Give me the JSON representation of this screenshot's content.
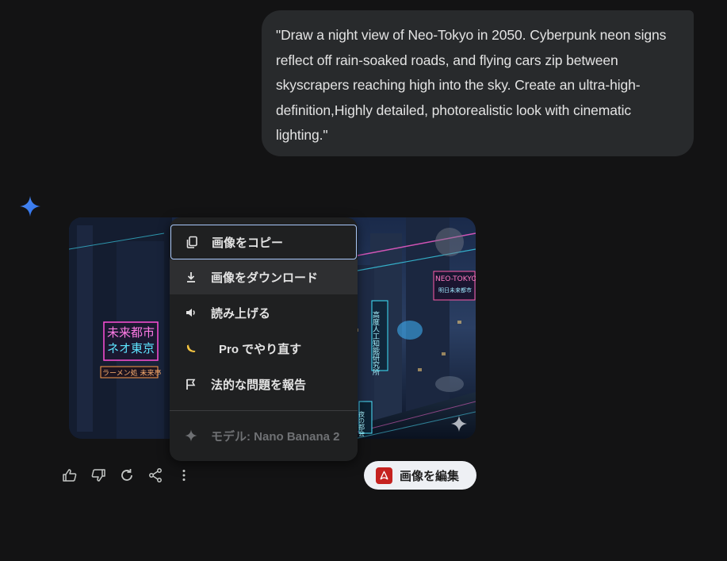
{
  "prompt": {
    "text": "\"Draw a night view of Neo-Tokyo in 2050. Cyberpunk neon signs reflect off rain-soaked roads, and flying cars zip between skyscrapers reaching high into the sky. Create an ultra-high-definition,Highly detailed, photorealistic look with cinematic lighting.\""
  },
  "response": {
    "avatar_icon": "gemini-sparkle-icon",
    "image": {
      "signs": {
        "left_1": "未来都市",
        "left_2": "ネオ東京",
        "ramen": "ラーメン処 未来亭",
        "right_top": "NEO-TOKYO",
        "right_sub": "明日未来都市",
        "vertical": "高度人工知能研究所",
        "night": "夜の都会"
      }
    }
  },
  "context_menu": {
    "items": [
      {
        "icon": "copy-icon",
        "label": "画像をコピー"
      },
      {
        "icon": "download-icon",
        "label": "画像をダウンロード"
      },
      {
        "icon": "speaker-icon",
        "label": "読み上げる"
      },
      {
        "icon": "banana-icon",
        "label": "Pro でやり直す"
      },
      {
        "icon": "flag-icon",
        "label": "法的な問題を報告"
      }
    ],
    "model_label": "モデル: Nano Banana 2"
  },
  "actions": {
    "icons": [
      "thumbs-up-icon",
      "thumbs-down-icon",
      "regenerate-icon",
      "share-icon",
      "more-vert-icon"
    ]
  },
  "edit_button": {
    "label": "画像を編集",
    "icon": "pdf-icon"
  },
  "colors": {
    "background": "#131314",
    "bubble": "#282a2c",
    "menu": "#1f2021",
    "focus_ring": "#a8c7fa",
    "pdf_red": "#c5221f"
  }
}
